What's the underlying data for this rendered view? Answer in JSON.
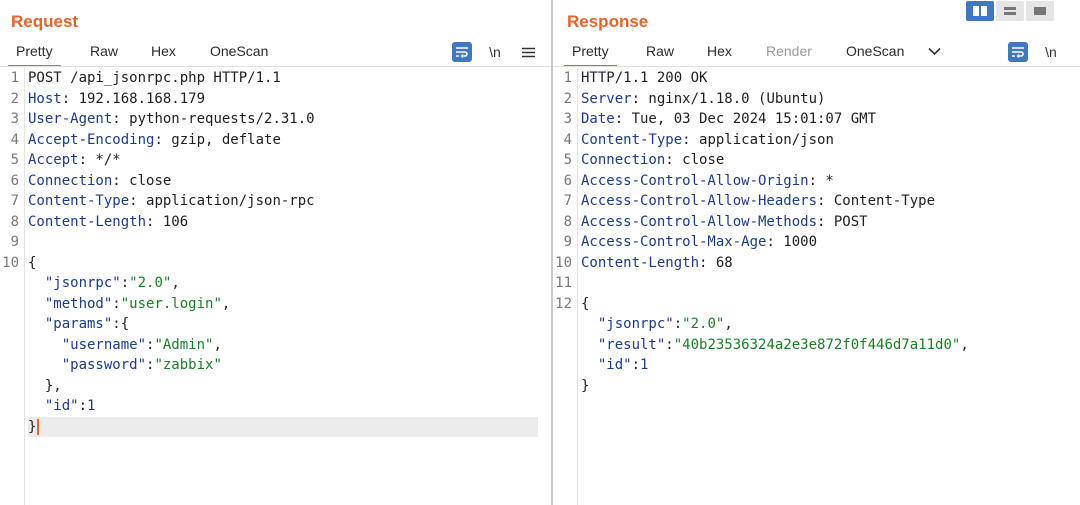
{
  "request": {
    "title": "Request",
    "tabs": [
      "Pretty",
      "Raw",
      "Hex",
      "OneScan"
    ],
    "tools": {
      "newline": "\\n"
    },
    "lines": [
      [
        {
          "t": "POST /api_jsonrpc.php HTTP/1.1",
          "c": ""
        }
      ],
      [
        {
          "t": "Host",
          "c": "k"
        },
        {
          "t": ": 192.168.168.179",
          "c": ""
        }
      ],
      [
        {
          "t": "User-Agent",
          "c": "k"
        },
        {
          "t": ": python-requests/2.31.0",
          "c": ""
        }
      ],
      [
        {
          "t": "Accept-Encoding",
          "c": "k"
        },
        {
          "t": ": gzip, deflate",
          "c": ""
        }
      ],
      [
        {
          "t": "Accept",
          "c": "k"
        },
        {
          "t": ": */*",
          "c": ""
        }
      ],
      [
        {
          "t": "Connection",
          "c": "k"
        },
        {
          "t": ": close",
          "c": ""
        }
      ],
      [
        {
          "t": "Content-Type",
          "c": "k"
        },
        {
          "t": ": application/json-rpc",
          "c": ""
        }
      ],
      [
        {
          "t": "Content-Length",
          "c": "k"
        },
        {
          "t": ": 106",
          "c": ""
        }
      ],
      [],
      [
        {
          "t": "{",
          "c": ""
        }
      ],
      [
        {
          "t": "  \"jsonrpc\"",
          "c": "k"
        },
        {
          "t": ":",
          "c": ""
        },
        {
          "t": "\"2.0\"",
          "c": "s"
        },
        {
          "t": ",",
          "c": ""
        }
      ],
      [
        {
          "t": "  \"method\"",
          "c": "k"
        },
        {
          "t": ":",
          "c": ""
        },
        {
          "t": "\"user.login\"",
          "c": "s"
        },
        {
          "t": ",",
          "c": ""
        }
      ],
      [
        {
          "t": "  \"params\"",
          "c": "k"
        },
        {
          "t": ":{",
          "c": ""
        }
      ],
      [
        {
          "t": "    \"username\"",
          "c": "k"
        },
        {
          "t": ":",
          "c": ""
        },
        {
          "t": "\"Admin\"",
          "c": "s"
        },
        {
          "t": ",",
          "c": ""
        }
      ],
      [
        {
          "t": "    \"password\"",
          "c": "k"
        },
        {
          "t": ":",
          "c": ""
        },
        {
          "t": "\"zabbix\"",
          "c": "s"
        }
      ],
      [
        {
          "t": "  },",
          "c": ""
        }
      ],
      [
        {
          "t": "  \"id\"",
          "c": "k"
        },
        {
          "t": ":",
          "c": ""
        },
        {
          "t": "1",
          "c": "n"
        }
      ],
      [
        {
          "t": "}",
          "c": ""
        }
      ]
    ],
    "line_numbers": [
      "1",
      "2",
      "3",
      "4",
      "5",
      "6",
      "7",
      "8",
      "9",
      "10",
      "",
      "",
      "",
      "",
      "",
      "",
      "",
      ""
    ]
  },
  "response": {
    "title": "Response",
    "tabs": [
      "Pretty",
      "Raw",
      "Hex",
      "Render",
      "OneScan"
    ],
    "tools": {
      "newline": "\\n"
    },
    "lines": [
      [
        {
          "t": "HTTP/1.1 200 OK",
          "c": ""
        }
      ],
      [
        {
          "t": "Server",
          "c": "k"
        },
        {
          "t": ": nginx/1.18.0 (Ubuntu)",
          "c": ""
        }
      ],
      [
        {
          "t": "Date",
          "c": "k"
        },
        {
          "t": ": Tue, 03 Dec 2024 15:01:07 GMT",
          "c": ""
        }
      ],
      [
        {
          "t": "Content-Type",
          "c": "k"
        },
        {
          "t": ": application/json",
          "c": ""
        }
      ],
      [
        {
          "t": "Connection",
          "c": "k"
        },
        {
          "t": ": close",
          "c": ""
        }
      ],
      [
        {
          "t": "Access-Control-Allow-Origin",
          "c": "k"
        },
        {
          "t": ": *",
          "c": ""
        }
      ],
      [
        {
          "t": "Access-Control-Allow-Headers",
          "c": "k"
        },
        {
          "t": ": Content-Type",
          "c": ""
        }
      ],
      [
        {
          "t": "Access-Control-Allow-Methods",
          "c": "k"
        },
        {
          "t": ": POST",
          "c": ""
        }
      ],
      [
        {
          "t": "Access-Control-Max-Age",
          "c": "k"
        },
        {
          "t": ": 1000",
          "c": ""
        }
      ],
      [
        {
          "t": "Content-Length",
          "c": "k"
        },
        {
          "t": ": 68",
          "c": ""
        }
      ],
      [],
      [
        {
          "t": "{",
          "c": ""
        }
      ],
      [
        {
          "t": "  \"jsonrpc\"",
          "c": "k"
        },
        {
          "t": ":",
          "c": ""
        },
        {
          "t": "\"2.0\"",
          "c": "s"
        },
        {
          "t": ",",
          "c": ""
        }
      ],
      [
        {
          "t": "  \"result\"",
          "c": "k"
        },
        {
          "t": ":",
          "c": ""
        },
        {
          "t": "\"40b23536324a2e3e872f0f446d7a11d0\"",
          "c": "s"
        },
        {
          "t": ",",
          "c": ""
        }
      ],
      [
        {
          "t": "  \"id\"",
          "c": "k"
        },
        {
          "t": ":",
          "c": ""
        },
        {
          "t": "1",
          "c": "n"
        }
      ],
      [
        {
          "t": "}",
          "c": ""
        }
      ]
    ],
    "line_numbers": [
      "1",
      "2",
      "3",
      "4",
      "5",
      "6",
      "7",
      "8",
      "9",
      "10",
      "11",
      "12",
      "",
      "",
      "",
      ""
    ]
  },
  "colors": {
    "accent": "#e8632a",
    "key": "#1e3a8a",
    "string": "#1a7f25",
    "wrap_button": "#3f78c0"
  }
}
